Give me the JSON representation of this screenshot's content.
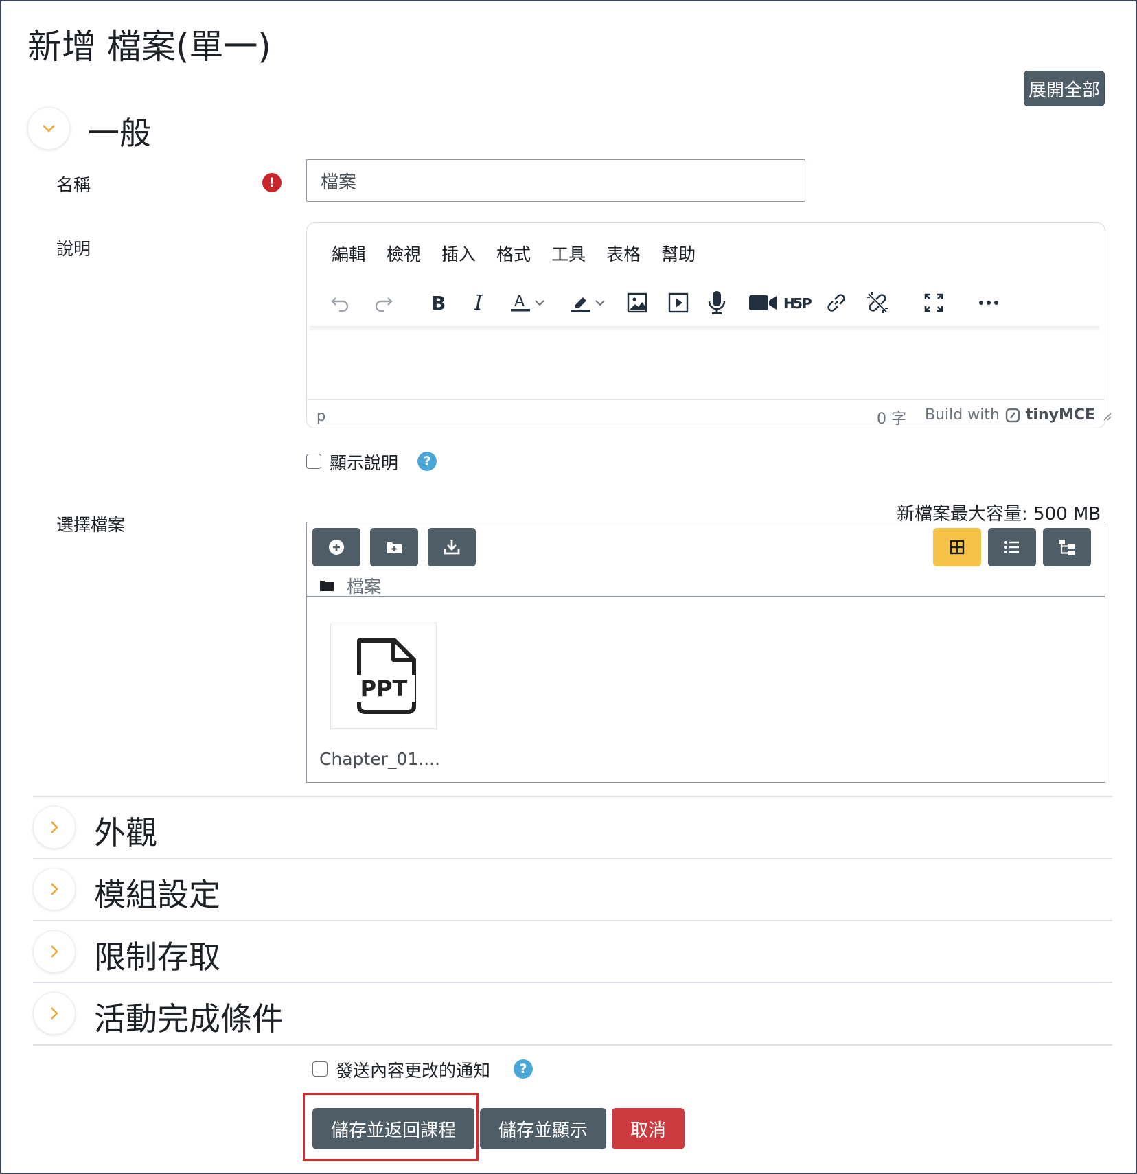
{
  "page_title": "新增 檔案(單一)",
  "expand_all_label": "展開全部",
  "sections": {
    "general": "一般",
    "appearance": "外觀",
    "module_settings": "模組設定",
    "restrict_access": "限制存取",
    "activity_completion": "活動完成條件"
  },
  "name_field": {
    "label": "名稱",
    "value": "檔案"
  },
  "description": {
    "label": "說明",
    "menu": [
      "編輯",
      "檢視",
      "插入",
      "格式",
      "工具",
      "表格",
      "幫助"
    ],
    "status_path": "p",
    "word_count": "0 字",
    "build_with": "Build with",
    "brand": "tinyMCE",
    "toolbar_icons": [
      "undo-icon",
      "redo-icon",
      "bold-icon",
      "italic-icon",
      "text-color-icon",
      "highlight-icon",
      "image-icon",
      "media-icon",
      "microphone-icon",
      "video-icon",
      "h5p-icon",
      "link-icon",
      "unlink-icon",
      "fullscreen-icon",
      "more-icon"
    ]
  },
  "show_description_label": "顯示說明",
  "file_select": {
    "label": "選擇檔案",
    "max_size_label": "新檔案最大容量:",
    "max_size_value": "500 MB",
    "path": "檔案",
    "file_type": "PPT",
    "file_name": "Chapter_01...."
  },
  "notify_label": "發送內容更改的通知",
  "buttons": {
    "save_return": "儲存並返回課程",
    "save_display": "儲存並顯示",
    "cancel": "取消"
  },
  "colors": {
    "dark_button": "#4e5d66",
    "cancel_button": "#ca3a3f",
    "active_view": "#f5c348",
    "help_icon": "#4aa8d8",
    "required_icon": "#c9262c",
    "chevron": "#f0a830",
    "highlight_box": "#e0262a"
  }
}
